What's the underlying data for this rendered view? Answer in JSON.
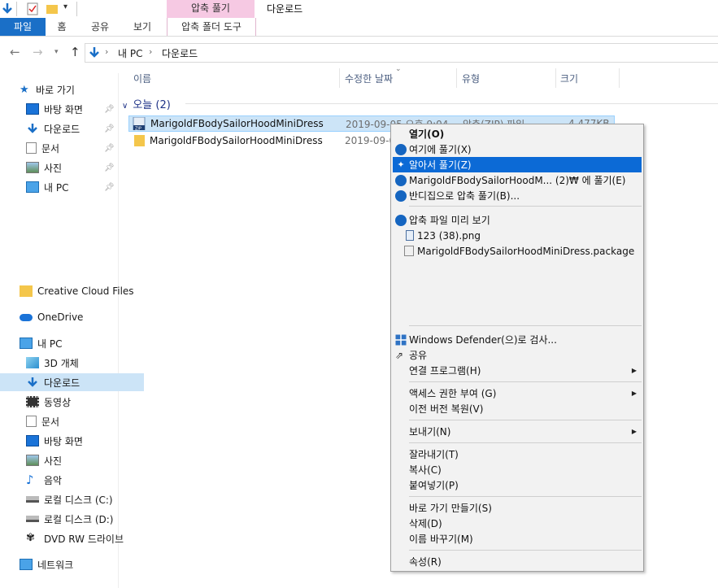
{
  "window": {
    "title": "다운로드",
    "context_tab_group": "압축 풀기"
  },
  "ribbon": {
    "tabs": [
      {
        "label": "파일"
      },
      {
        "label": "홈"
      },
      {
        "label": "공유"
      },
      {
        "label": "보기"
      },
      {
        "label": "압축 폴더 도구"
      }
    ]
  },
  "address": {
    "breadcrumb": [
      "내 PC",
      "다운로드"
    ]
  },
  "nav": {
    "quick_access": "바로 가기",
    "quick_items": [
      "바탕 화면",
      "다운로드",
      "문서",
      "사진",
      "내 PC"
    ],
    "creative_cloud": "Creative Cloud Files",
    "onedrive": "OneDrive",
    "this_pc": "내 PC",
    "pc_items": [
      "3D 개체",
      "다운로드",
      "동영상",
      "문서",
      "바탕 화면",
      "사진",
      "음악",
      "로컬 디스크 (C:)",
      "로컬 디스크 (D:)",
      "DVD RW 드라이브"
    ],
    "selected_item": "다운로드",
    "network": "네트워크"
  },
  "columns": {
    "name": "이름",
    "modified": "수정한 날짜",
    "type": "유형",
    "size": "크기"
  },
  "group": {
    "label": "오늘 (2)"
  },
  "files": [
    {
      "name": "MarigoldFBodySailorHoodMiniDress",
      "modified": "2019-09-05 오후 9:04",
      "type": "압축(ZIP) 파일",
      "size": "4,477KB",
      "selected": true
    },
    {
      "name": "MarigoldFBodySailorHoodMiniDress",
      "modified": "2019-09-0",
      "type": "",
      "size": "",
      "selected": false
    }
  ],
  "context_menu": {
    "open": "열기(O)",
    "extract_here": "여기에 풀기(X)",
    "smart_extract": "알아서 풀기(Z)",
    "extract_to": "MarigoldFBodySailorHoodM... (2)₩ 에 풀기(E)",
    "bandizip_extract": "반디집으로 압축 풀기(B)...",
    "preview": "압축 파일 미리 보기",
    "preview_items": [
      "123 (38).png",
      "MarigoldFBodySailorHoodMiniDress.package"
    ],
    "defender": "Windows Defender(으)로 검사...",
    "share": "공유",
    "open_with": "연결 프로그램(H)",
    "grant_access": "액세스 권한 부여 (G)",
    "restore_versions": "이전 버전 복원(V)",
    "send_to": "보내기(N)",
    "cut": "잘라내기(T)",
    "copy": "복사(C)",
    "paste": "붙여넣기(P)",
    "create_shortcut": "바로 가기 만들기(S)",
    "delete": "삭제(D)",
    "rename": "이름 바꾸기(M)",
    "properties": "속성(R)"
  },
  "colors": {
    "accent": "#1a6fc7",
    "selection": "#cce4f7",
    "menu_highlight": "#0c6ad6",
    "context_tab": "#f6c9e3"
  }
}
